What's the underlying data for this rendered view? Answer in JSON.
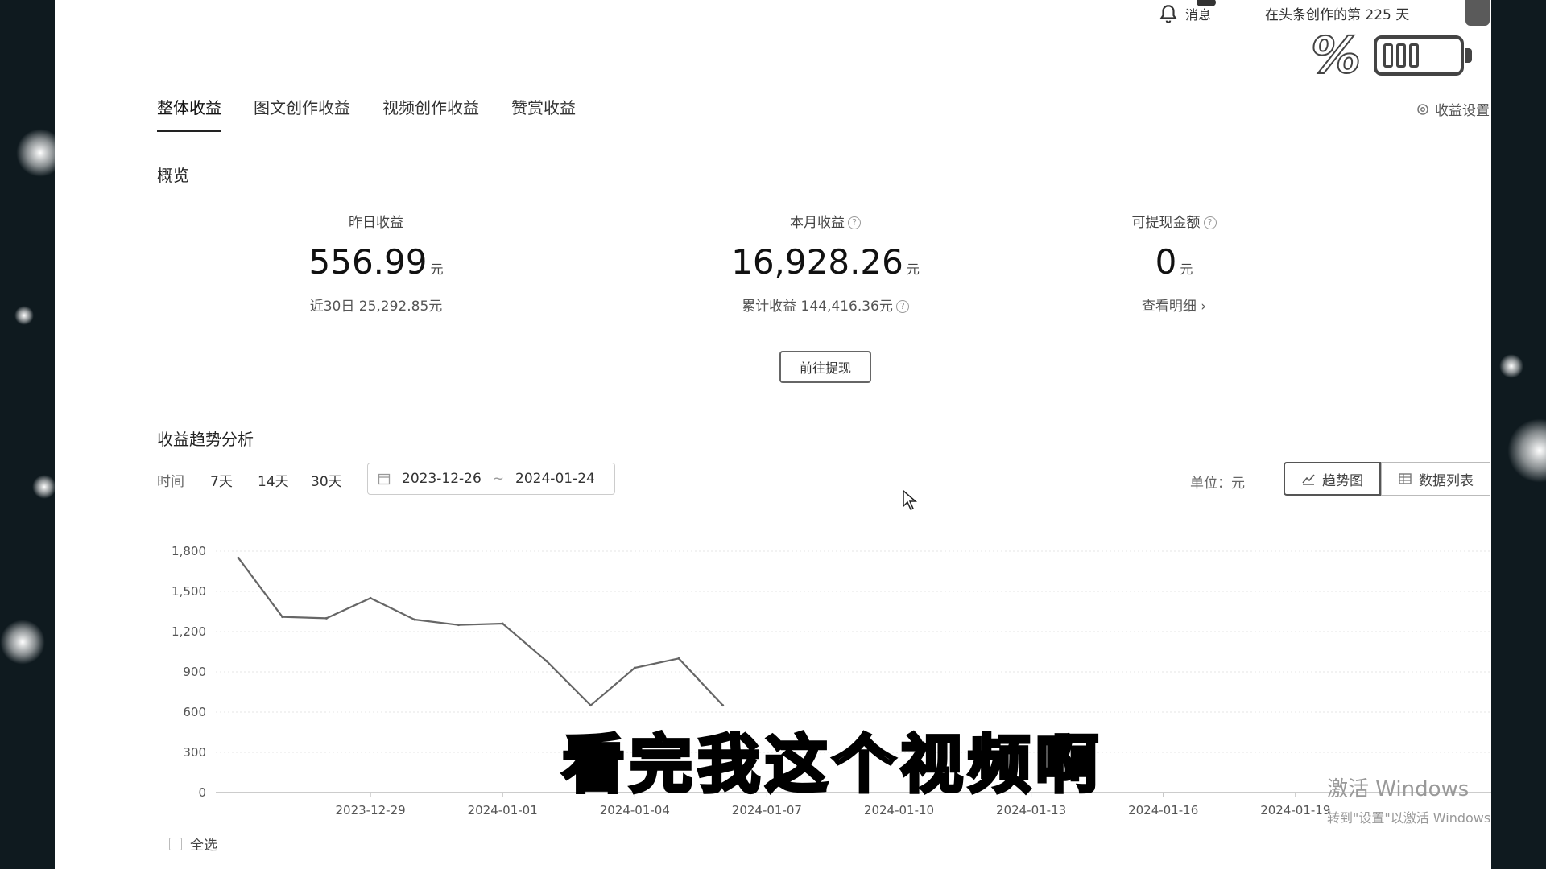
{
  "topbar": {
    "messages_label": "消息",
    "creation_days": "在头条创作的第 225 天"
  },
  "overlay_battery": {
    "percent_symbol": "%"
  },
  "tabs": [
    {
      "label": "整体收益",
      "active": true
    },
    {
      "label": "图文创作收益",
      "active": false
    },
    {
      "label": "视频创作收益",
      "active": false
    },
    {
      "label": "赞赏收益",
      "active": false
    }
  ],
  "settings_label": "收益设置",
  "overview": {
    "title": "概览",
    "yesterday": {
      "label": "昨日收益",
      "value": "556.99",
      "unit": "元",
      "sub": "近30日 25,292.85元"
    },
    "month": {
      "label": "本月收益",
      "value": "16,928.26",
      "unit": "元",
      "sub": "累计收益 144,416.36元"
    },
    "withdrawable": {
      "label": "可提现金额",
      "value": "0",
      "unit": "元",
      "sub": "查看明细 ›"
    },
    "withdraw_button": "前往提现"
  },
  "trend": {
    "title": "收益趋势分析",
    "time_label": "时间",
    "ranges": [
      "7天",
      "14天",
      "30天"
    ],
    "date_start": "2023-12-26",
    "date_sep": "~",
    "date_end": "2024-01-24",
    "unit_label": "单位：元",
    "view_trend": "趋势图",
    "view_table": "数据列表",
    "select_all": "全选"
  },
  "chart_data": {
    "type": "line",
    "x": [
      "2023-12-26",
      "2023-12-27",
      "2023-12-28",
      "2023-12-29",
      "2023-12-30",
      "2023-12-31",
      "2024-01-01",
      "2024-01-02",
      "2024-01-03",
      "2024-01-04",
      "2024-01-05",
      "2024-01-06"
    ],
    "series": [
      {
        "values": [
          1750,
          1310,
          1300,
          1450,
          1290,
          1250,
          1260,
          980,
          650,
          930,
          1000,
          650
        ]
      }
    ],
    "x_tick_labels": [
      "2023-12-29",
      "2024-01-01",
      "2024-01-04",
      "2024-01-07",
      "2024-01-10",
      "2024-01-13",
      "2024-01-16",
      "2024-01-19"
    ],
    "y_tick_labels": [
      "0",
      "300",
      "600",
      "900",
      "1,200",
      "1,500",
      "1,800"
    ],
    "ylim": [
      0,
      1800
    ],
    "grid": true,
    "line_color": "#666666"
  },
  "subtitle_text": "看完我这个视频啊",
  "watermark": {
    "line1": "激活 Windows",
    "line2": "转到\"设置\"以激活 Windows"
  }
}
